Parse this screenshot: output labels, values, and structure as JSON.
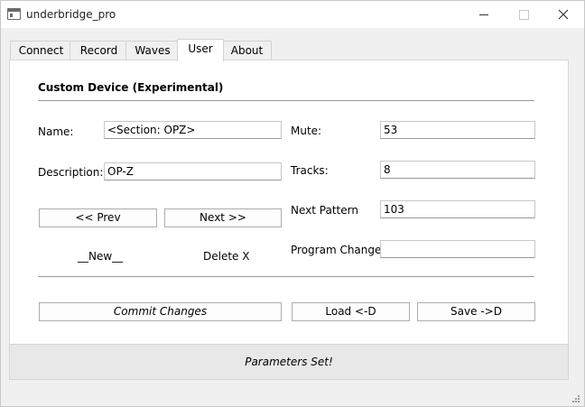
{
  "window": {
    "title": "underbridge_pro",
    "controls": {
      "minimize": "minimize",
      "maximize": "maximize",
      "close": "close"
    }
  },
  "tabs": [
    {
      "label": "Connect",
      "active": false
    },
    {
      "label": "Record",
      "active": false
    },
    {
      "label": "Waves",
      "active": false
    },
    {
      "label": "User",
      "active": true
    },
    {
      "label": "About",
      "active": false
    }
  ],
  "user_panel": {
    "section_title": "Custom Device (Experimental)",
    "name_label": "Name:",
    "name_value": "<Section: OPZ>",
    "description_label": "Description:",
    "description_value": "OP-Z",
    "prev_button": "<< Prev",
    "next_button": "Next >>",
    "new_button": "__New__",
    "delete_button": "Delete X",
    "mute_label": "Mute:",
    "mute_value": "53",
    "tracks_label": "Tracks:",
    "tracks_value": "8",
    "next_pattern_label": "Next Pattern",
    "next_pattern_value": "103",
    "program_change_label": "Program Change:",
    "program_change_value": "",
    "commit_button": "Commit Changes",
    "load_button": "Load <-D",
    "save_button": "Save ->D"
  },
  "status": {
    "text": "Parameters Set!"
  }
}
